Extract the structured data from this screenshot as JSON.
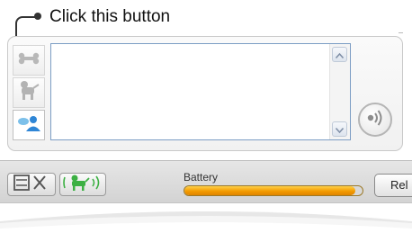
{
  "callout": {
    "text": "Click this button"
  },
  "side_tabs": [
    {
      "icon": "bone-icon"
    },
    {
      "icon": "dog-icon"
    },
    {
      "icon": "chat-people-icon"
    }
  ],
  "message_box": {
    "value": ""
  },
  "scrollbar": {
    "up_icon": "chevron-up-icon",
    "down_icon": "chevron-down-icon"
  },
  "speak_button": {
    "icon": "speaker-waves-icon"
  },
  "toolbar": {
    "screen_close_icon": "screen-close-icon",
    "dog_sound_icon": "dog-sound-icon",
    "battery_label": "Battery",
    "battery_level_percent": 96,
    "release_label": "Rel"
  },
  "colors": {
    "accent_blue": "#2f86d6",
    "battery_orange": "#f39a00",
    "dog_green": "#3cb043"
  }
}
